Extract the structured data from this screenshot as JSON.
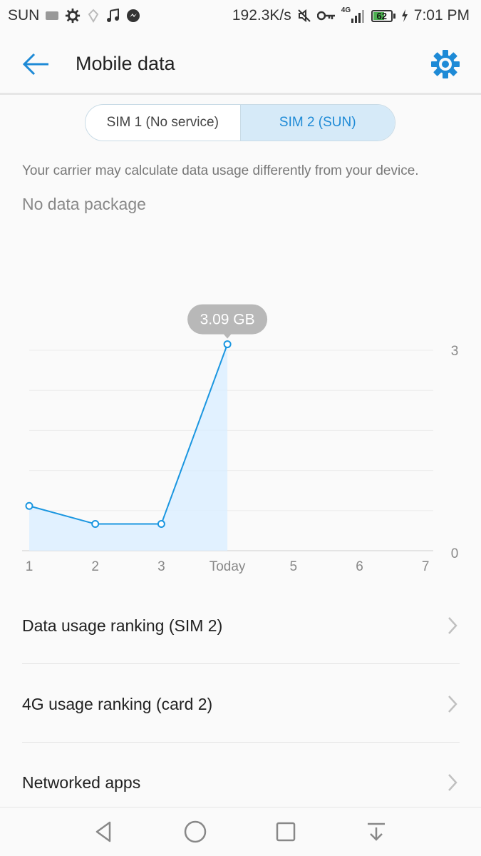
{
  "statusbar": {
    "carrier": "SUN",
    "speed": "192.3K/s",
    "network": "4G",
    "battery": "62",
    "battery_percent": 62,
    "time": "7:01 PM"
  },
  "appbar": {
    "title": "Mobile data"
  },
  "sim_toggle": {
    "sim1": "SIM 1 (No service)",
    "sim2": "SIM 2 (SUN)",
    "selected": "sim2"
  },
  "carrier_note": "Your carrier may calculate data usage differently from your device.",
  "package_status": "No data package",
  "chart_data": {
    "type": "area",
    "categories": [
      "1",
      "2",
      "3",
      "Today",
      "5",
      "6",
      "7"
    ],
    "values": [
      0.67,
      0.4,
      0.4,
      3.09,
      null,
      null,
      null
    ],
    "y_ticks": [
      "3",
      "0"
    ],
    "ylim": [
      0,
      3
    ],
    "highlight_label": "3.09 GB",
    "grid": true,
    "colors": {
      "line": "#1a96e0",
      "fill": "#dcefff",
      "tooltip": "#b8b8b8"
    }
  },
  "list": {
    "items": [
      {
        "label": "Data usage ranking (SIM 2)"
      },
      {
        "label": "4G usage ranking (card 2)"
      },
      {
        "label": "Networked apps"
      }
    ]
  },
  "colors": {
    "accent": "#1e8ad6"
  }
}
